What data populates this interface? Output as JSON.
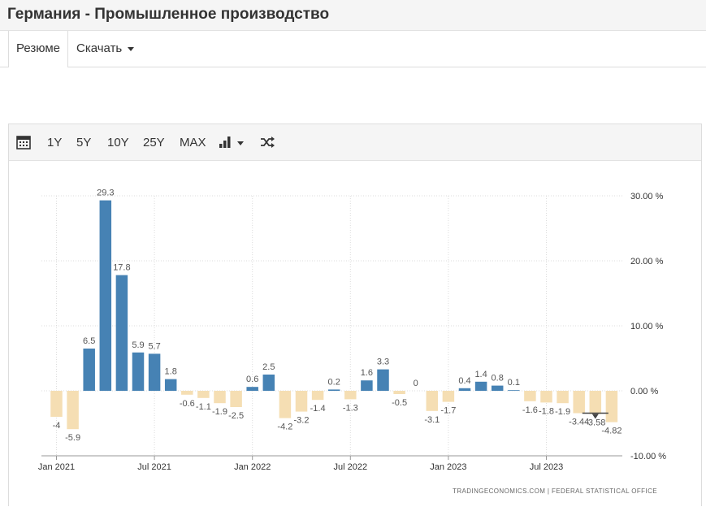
{
  "page": {
    "title": "Германия - Промышленное производство"
  },
  "tabs": [
    {
      "label": "Резюме"
    },
    {
      "label": "Скачать"
    }
  ],
  "toolbar": {
    "calendar_icon": "calendar-icon",
    "ranges": [
      "1Y",
      "5Y",
      "10Y",
      "25Y",
      "MAX"
    ],
    "chart_type_icon": "bar-chart-icon",
    "compare_icon": "shuffle-icon"
  },
  "source": "TRADINGECONOMICS.COM  |  FEDERAL STATISTICAL OFFICE",
  "colors": {
    "positive": "#4682b4",
    "negative": "#f5deb3",
    "grid": "#dcdcdc",
    "label": "#555555"
  },
  "chart_data": {
    "type": "bar",
    "ylim": [
      -10,
      30
    ],
    "yticks": [
      30,
      20,
      10,
      0,
      -10
    ],
    "ytick_labels": [
      "30.00 %",
      "20.00 %",
      "10.00 %",
      "0.00 %",
      "-10.00 %"
    ],
    "x_tick_labels": [
      "Jan 2021",
      "Jul 2021",
      "Jan 2022",
      "Jul 2022",
      "Jan 2023",
      "Jul 2023"
    ],
    "x_tick_indices": [
      0,
      6,
      12,
      18,
      24,
      30
    ],
    "grid": true,
    "y_axis_position": "right",
    "values": [
      -4,
      -5.9,
      6.5,
      29.3,
      17.8,
      5.9,
      5.7,
      1.8,
      -0.6,
      -1.1,
      -1.9,
      -2.5,
      0.6,
      2.5,
      -4.2,
      -3.2,
      -1.4,
      0.2,
      -1.3,
      1.6,
      3.3,
      -0.5,
      0,
      -3.1,
      -1.7,
      0.4,
      1.4,
      0.8,
      0.1,
      -1.6,
      -1.8,
      -1.9,
      -3.44,
      -3.58,
      -4.82
    ],
    "data_labels": [
      "-4",
      "-5.9",
      "6.5",
      "29.3",
      "17.8",
      "5.9",
      "5.7",
      "1.8",
      "-0.6",
      "-1.1",
      "-1.9",
      "-2.5",
      "0.6",
      "2.5",
      "-4.2",
      "-3.2",
      "-1.4",
      "0.2",
      "-1.3",
      "1.6",
      "3.3",
      "-0.5",
      "0",
      "-3.1",
      "-1.7",
      "0.4",
      "1.4",
      "0.8",
      "0.1",
      "-1.6",
      "-1.8",
      "-1.9",
      "-3.44",
      "-3.58",
      "-4.82"
    ]
  }
}
